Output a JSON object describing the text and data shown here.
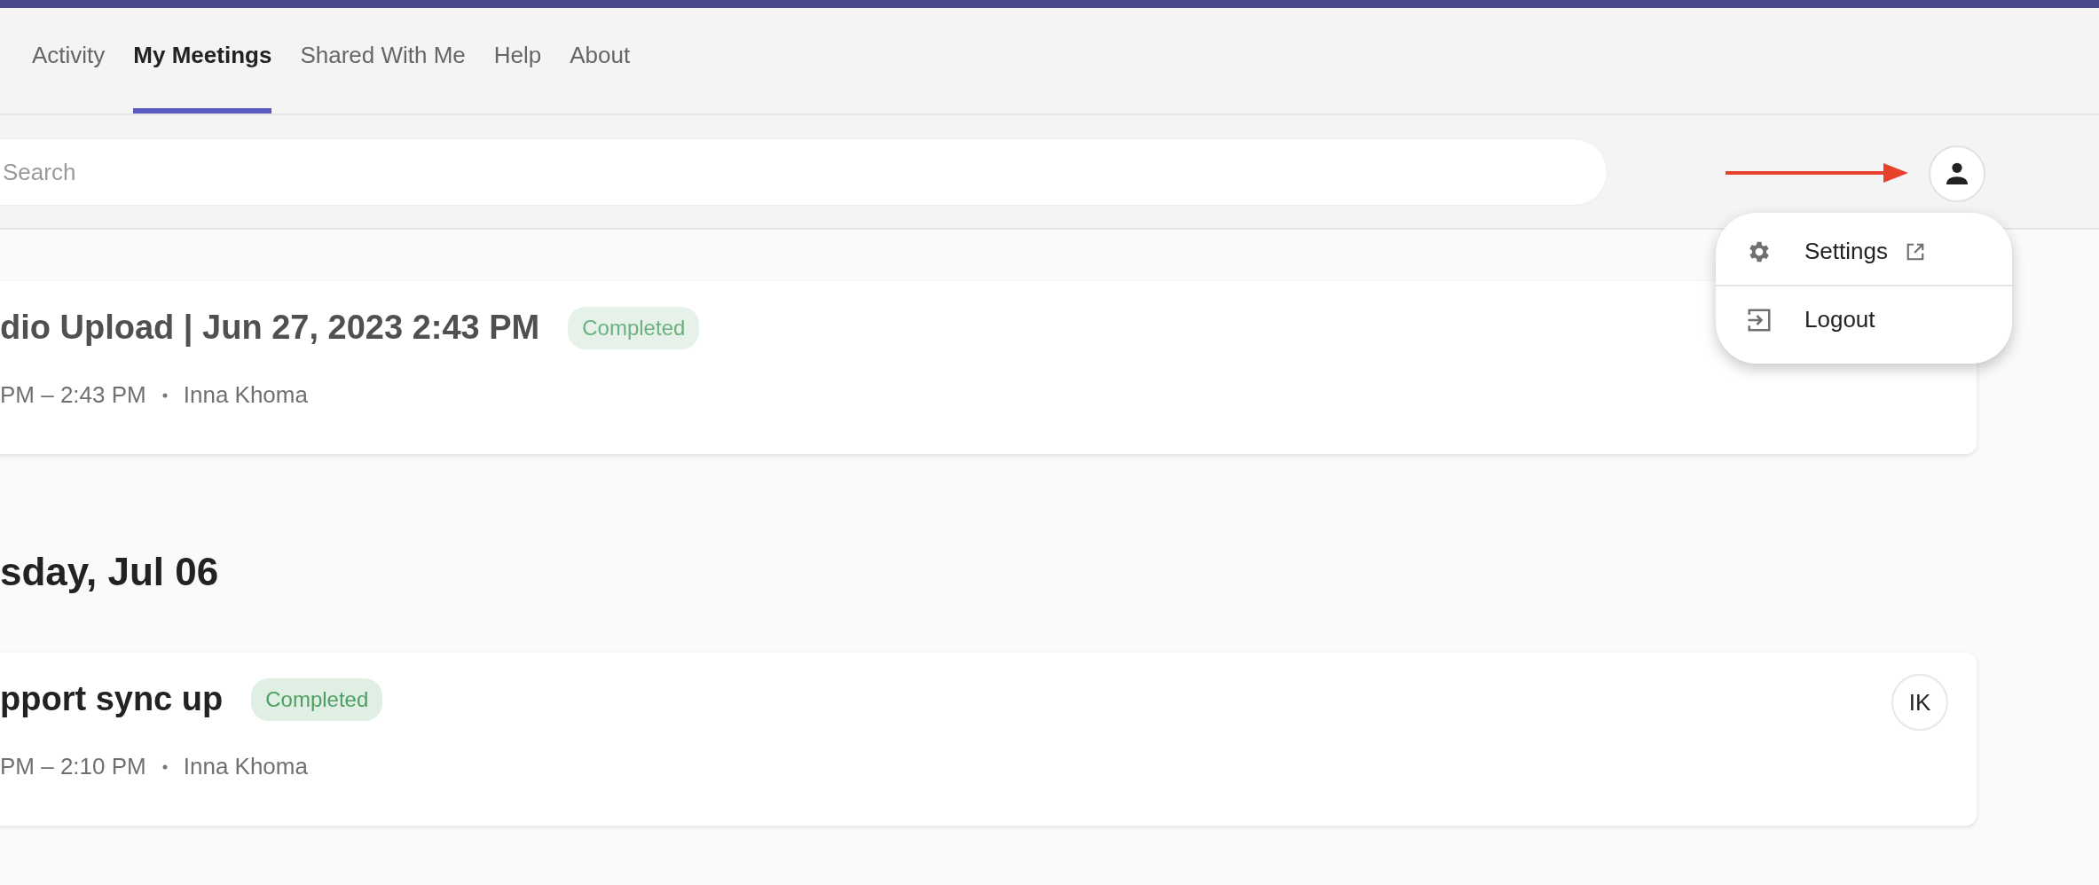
{
  "nav": {
    "tabs": [
      {
        "label": "Activity",
        "selected": false
      },
      {
        "label": "My Meetings",
        "selected": true
      },
      {
        "label": "Shared With Me",
        "selected": false
      },
      {
        "label": "Help",
        "selected": false
      },
      {
        "label": "About",
        "selected": false
      }
    ]
  },
  "search": {
    "placeholder": "Search"
  },
  "user_menu": {
    "open": true,
    "items": [
      {
        "kind": "settings",
        "label": "Settings",
        "external": true
      },
      {
        "kind": "logout",
        "label": "Logout",
        "external": false
      }
    ]
  },
  "groups": [
    {
      "meetings": [
        {
          "title": "dio Upload | Jun 27, 2023 2:43 PM",
          "status": "Completed",
          "time": "PM – 2:43 PM",
          "owner": "Inna Khoma",
          "muted": true
        }
      ]
    },
    {
      "heading": "sday, Jul 06",
      "meetings": [
        {
          "title": "pport sync up",
          "status": "Completed",
          "time": "PM – 2:10 PM",
          "owner": "Inna Khoma",
          "muted": false,
          "participants": [
            "IK"
          ]
        }
      ]
    }
  ]
}
